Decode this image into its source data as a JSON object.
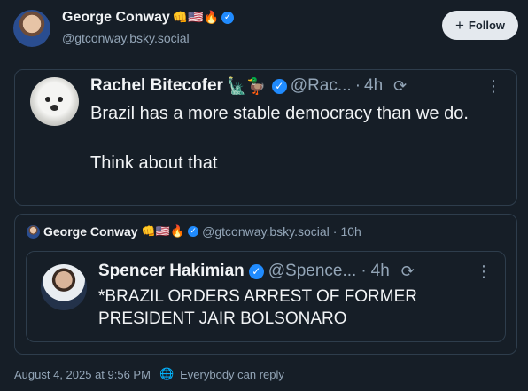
{
  "post": {
    "author_name": "George Conway",
    "author_emojis": "👊🇺🇸🔥",
    "author_handle": "@gtconway.bsky.social",
    "follow_label": "Follow",
    "follow_plus": "+",
    "verified_icon": "✓"
  },
  "quote1": {
    "author_name": "Rachel Bitecofer",
    "author_emojis": "🗽🦆",
    "author_handle": "@Rac...",
    "separator": "·",
    "time": "4h",
    "text": "Brazil has a more stable democracy than we do.\n\nThink about that",
    "more_icon": "⋮",
    "repost_icon": "⟳"
  },
  "quote2": {
    "author_name": "George Conway",
    "author_emojis": "👊🇺🇸🔥",
    "author_handle": "@gtconway.bsky.social",
    "separator": "·",
    "time": "10h",
    "nested": {
      "author_name": "Spencer Hakimian",
      "author_handle": "@Spence...",
      "separator": "·",
      "time": "4h",
      "text": "*BRAZIL ORDERS ARREST OF FORMER PRESIDENT JAIR BOLSONARO",
      "more_icon": "⋮",
      "repost_icon": "⟳"
    }
  },
  "footer": {
    "timestamp": "August 4, 2025 at 9:56 PM",
    "globe_icon": "🌐",
    "reply_setting": "Everybody can reply"
  },
  "colors": {
    "background": "#161e27",
    "text": "#f1f3f5",
    "muted": "#93a5b7",
    "border": "#2e3d4c",
    "verified": "#208bfe",
    "follow_bg": "#e4e9ee"
  }
}
